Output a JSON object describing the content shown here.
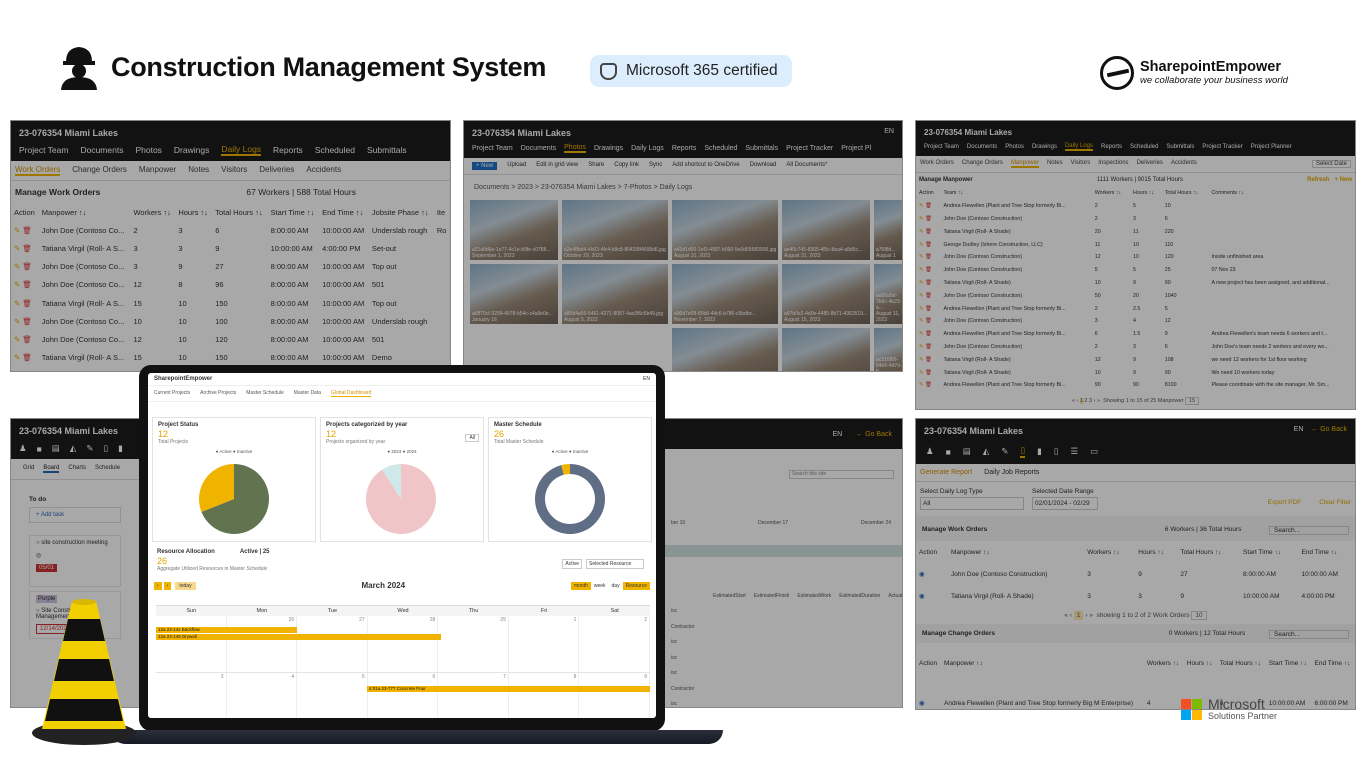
{
  "header": {
    "title": "Construction Management System",
    "badge": "Microsoft 365 certified",
    "logo_name": "SharepointEmpower",
    "logo_tagline": "we collaborate your business world"
  },
  "p1": {
    "title": "23-076354 Miami Lakes",
    "tabs": [
      "Project Team",
      "Documents",
      "Photos",
      "Drawings",
      "Daily Logs",
      "Reports",
      "Scheduled",
      "Submittals"
    ],
    "subtabs": [
      "Work Orders",
      "Change Orders",
      "Manpower",
      "Notes",
      "Visitors",
      "Deliveries",
      "Accidents"
    ],
    "heading": "Manage Work Orders",
    "summary": "67 Workers | 588 Total Hours",
    "cols": [
      "Action",
      "Manpower ↑↓",
      "Workers ↑↓",
      "Hours ↑↓",
      "Total Hours ↑↓",
      "Start Time ↑↓",
      "End Time ↑↓",
      "Jobsite Phase ↑↓",
      "Ite"
    ],
    "rows": [
      [
        "John Doe (Contoso Co...",
        "2",
        "3",
        "6",
        "8:00:00 AM",
        "10:00:00 AM",
        "Underslab rough",
        "Ro"
      ],
      [
        "Tatiana Virgil (Roll- A S...",
        "3",
        "3",
        "9",
        "10:00:00 AM",
        "4:00:00 PM",
        "Set-out",
        ""
      ],
      [
        "John Doe (Contoso Co...",
        "3",
        "9",
        "27",
        "8:00:00 AM",
        "10:00:00 AM",
        "Top out",
        ""
      ],
      [
        "John Doe (Contoso Co...",
        "12",
        "8",
        "96",
        "8:00:00 AM",
        "10:00:00 AM",
        "501",
        ""
      ],
      [
        "Tatiana Virgil (Roll- A S...",
        "15",
        "10",
        "150",
        "8:00:00 AM",
        "10:00:00 AM",
        "Top out",
        ""
      ],
      [
        "John Doe (Contoso Co...",
        "10",
        "10",
        "100",
        "8:00:00 AM",
        "10:00:00 AM",
        "Underslab rough",
        ""
      ],
      [
        "John Doe (Contoso Co...",
        "12",
        "10",
        "120",
        "8:00:00 AM",
        "10:00:00 AM",
        "501",
        ""
      ],
      [
        "Tatiana Virgil (Roll- A S...",
        "15",
        "10",
        "150",
        "8:00:00 AM",
        "10:00:00 AM",
        "Demo",
        ""
      ]
    ]
  },
  "p2": {
    "title": "23-076354 Miami Lakes",
    "lang": "EN",
    "tabs": [
      "Project Team",
      "Documents",
      "Photos",
      "Drawings",
      "Daily Logs",
      "Reports",
      "Scheduled",
      "Submittals",
      "Project Tracker",
      "Project Pl"
    ],
    "toolbar": [
      "+ New",
      "Upload",
      "Edit in grid view",
      "Share",
      "Copy link",
      "Sync",
      "Add shortcut to OneDrive",
      "Download",
      "All Documents*"
    ],
    "breadcrumb": "Documents > 2023 > 23-076354 Miami Lakes > 7-Photos > Daily Logs",
    "photos": [
      {
        "name": "a21a8d6e-1e77-4c1e-b9fe-c0788...",
        "date": "September 1, 2023"
      },
      {
        "name": "a2e48bd4-4b03-4fc4-b9c8-8042084698d6.jpg",
        "date": "October 29, 2023"
      },
      {
        "name": "a43d1d00-1ef3-4997-b090-5e0d09583906.jpg",
        "date": "August 31, 2023"
      },
      {
        "name": "ae40c745-8365-4f5c-8ea4-a8d5c...",
        "date": "August 31, 2023"
      },
      {
        "name": "a76f8d...",
        "date": "August 1"
      },
      {
        "name": "a6ff79cf-3299-4978-b54c-c4a9e0e...",
        "date": "January 16"
      },
      {
        "name": "a80d4a56-5461-4271-8087-4ac0f6c6b49.jpg",
        "date": "August 5, 2023"
      },
      {
        "name": "a90d7e08-80b8-44c6-b786-c5bdbc...",
        "date": "November 7, 2023"
      },
      {
        "name": "a97b0e2-4d0e-4485-8b71-4363519...",
        "date": "August 15, 2023"
      },
      {
        "name": "aa56a5d-7b6c-4b23-a...",
        "date": "August 11, 2023"
      },
      {
        "name": "",
        "date": ""
      },
      {
        "name": "",
        "date": ""
      },
      {
        "name": "aa03a7d-0e5c-4e43-a3c7-af34736...",
        "date": "August 30, 2023"
      },
      {
        "name": "abcd01b-6b4a-4b44-b00a-c0b4836...",
        "date": "August 1, 2023"
      },
      {
        "name": "ac316f66-64e5-4d7d-8...",
        "date": "August 5, 2023"
      }
    ]
  },
  "p3": {
    "title": "23-076354 Miami Lakes",
    "tabs": [
      "Project Team",
      "Documents",
      "Photos",
      "Drawings",
      "Daily Logs",
      "Reports",
      "Scheduled",
      "Submittals",
      "Project Tracker",
      "Project Planner"
    ],
    "subtabs": [
      "Work Orders",
      "Change Orders",
      "Manpower",
      "Notes",
      "Visitors",
      "Inspections",
      "Deliveries",
      "Accidents"
    ],
    "heading": "Manage Manpower",
    "summary": "1111 Workers | 9015 Total Hours",
    "refresh": "Refresh",
    "add": "+ New",
    "select_date": "Select Date",
    "cols": [
      "Action",
      "Team ↑↓",
      "Workers ↑↓",
      "Hours ↑↓",
      "Total Hours ↑↓",
      "Comments ↑↓"
    ],
    "rows": [
      [
        "Andrea Flewellen (Plant and Tree Stop formerly Bi...",
        "2",
        "5",
        "10",
        ""
      ],
      [
        "John Doe (Contoso Construction)",
        "2",
        "3",
        "6",
        ""
      ],
      [
        "Tatiana Virgil (Roll- A Shade)",
        "20",
        "11",
        "220",
        ""
      ],
      [
        "George Dudley (Ishere Construction, LLC)",
        "11",
        "10",
        "110",
        ""
      ],
      [
        "John Doe (Contoso Construction)",
        "12",
        "10",
        "120",
        "Inside unfinished area"
      ],
      [
        "John Doe (Contoso Construction)",
        "5",
        "5",
        "25",
        "07 Nov 23"
      ],
      [
        "Tatiana Virgil (Roll- A Shade)",
        "10",
        "9",
        "90",
        "A new project has been assigned, and additional..."
      ],
      [
        "John Doe (Contoso Construction)",
        "50",
        "20",
        "1040",
        ""
      ],
      [
        "Andrea Flewellen (Plant and Tree Stop formerly Bi...",
        "2",
        "2.5",
        "5",
        ""
      ],
      [
        "John Doe (Contoso Construction)",
        "3",
        "4",
        "12",
        ""
      ],
      [
        "Andrea Flewellen (Plant and Tree Stop formerly Bi...",
        "6",
        "1.5",
        "9",
        "Andrea Flewellen's team needs 6 workers and t..."
      ],
      [
        "John Doe (Contoso Construction)",
        "2",
        "3",
        "6",
        "John Doe's team needs 2 workers and every wo..."
      ],
      [
        "Tatiana Virgil (Roll- A Shade)",
        "12",
        "9",
        "108",
        "we need 12 workers for 1st floor working"
      ],
      [
        "Tatiana Virgil (Roll- A Shade)",
        "10",
        "9",
        "90",
        "We need 10 workers today"
      ],
      [
        "Andrea Flewellen (Plant and Tree Stop formerly Bi...",
        "90",
        "90",
        "8100",
        "Please coordinate with the site manager, Mr. Sm..."
      ]
    ],
    "paging": "Showing 1 to 15 of 25 Manpower",
    "pages": [
      "1",
      "2",
      "3"
    ],
    "per_page": "15"
  },
  "p4": {
    "title": "23-076354 Miami Lakes",
    "views": [
      "Grid",
      "Board",
      "Charts",
      "Schedule"
    ],
    "todo": "To do",
    "add_task": "+ Add task",
    "tasks": [
      "site construction meeting",
      "Site Construction Management"
    ],
    "date1": "05/01",
    "tag": "Purple",
    "date2": "12/14/2023"
  },
  "p5": {
    "lang": "EN",
    "back": "Go Back",
    "search": "Search this site",
    "dates": [
      "ber 10",
      "December 17",
      "December 24"
    ],
    "cols": [
      "EstimatedStart",
      "EstimatedFinish",
      "EstimatedWork",
      "EstimatedDuration",
      "ActualStart"
    ],
    "frags": [
      "isc",
      "Contractor",
      "isc",
      "isc",
      "isc",
      "Contractor",
      "isc"
    ]
  },
  "p6": {
    "title": "23-076354 Miami Lakes",
    "lang": "EN",
    "back": "Go Back",
    "tabs": [
      "Generate Report",
      "Daily Job Reports"
    ],
    "filter1_label": "Select Daily Log Type",
    "filter1_value": "All",
    "filter2_label": "Selected Date Range",
    "filter2_value": "02/01/2024 - 02/29",
    "export": "Export PDF",
    "clear": "Clear Filter",
    "heading": "Manage Work Orders",
    "summary": "6 Workers | 36 Total Hours",
    "search": "Search...",
    "cols": [
      "Action",
      "Manpower ↑↓",
      "Workers ↑↓",
      "Hours ↑↓",
      "Total Hours ↑↓",
      "Start Time ↑↓",
      "End Time ↑↓"
    ],
    "rows": [
      [
        "John Doe (Contoso Construction)",
        "3",
        "9",
        "27",
        "8:00:00 AM",
        "10:00:00 AM"
      ],
      [
        "Tatiana Virgil (Roll- A Shade)",
        "3",
        "3",
        "9",
        "10:00:00 AM",
        "4:00:00 PM"
      ]
    ],
    "paging": "showing 1 to 2 of 2 Work Orders",
    "page": "1",
    "per_page": "10",
    "heading2": "Manage Change Orders",
    "summary2": "0 Workers | 12 Total Hours",
    "search2": "Search...",
    "cols2": [
      "Action",
      "Manpower ↑↓",
      "Workers ↑↓",
      "Hours ↑↓",
      "Total Hours ↑↓",
      "Start Time ↑↓",
      "End Time ↑↓"
    ],
    "rows2": [
      [
        "Andrea Flewellen (Plant and Tree Stop formerly Big M Enterprise)",
        "4",
        "2",
        "8",
        "10:00:00 AM",
        "6:00:00 PM"
      ]
    ]
  },
  "laptop": {
    "logo": "SharepointEmpower",
    "lang": "EN",
    "nav": [
      "Current Projects",
      "Archive Projects",
      "Master Schedule",
      "Master Data",
      "Global Dashboard"
    ],
    "cards": [
      {
        "title": "Project Status",
        "num": "12",
        "sub": "Total Projects",
        "legend": [
          "Active",
          "Inactive"
        ]
      },
      {
        "title": "Projects categorized by year",
        "num": "12",
        "sub": "Projects organized by year",
        "legend": [
          "2023",
          "2024"
        ],
        "select": "All"
      },
      {
        "title": "Master Schedule",
        "num": "26",
        "sub": "Total Master Schedule",
        "legend": [
          "Active",
          "Inactive"
        ]
      }
    ],
    "resource": {
      "title": "Resource Allocation",
      "active": "Active | 25",
      "num": "26",
      "sub": "Aggregate Utilized Resources in Master Schedule",
      "sel1": "Active",
      "sel2": "Selected Resource"
    },
    "calendar": {
      "title": "March 2024",
      "today": "today",
      "views": [
        "month",
        "week",
        "day",
        "Resource"
      ],
      "days": [
        "Sun",
        "Mon",
        "Tue",
        "Wed",
        "Thu",
        "Fri",
        "Sat"
      ],
      "row1": [
        "",
        "26",
        "27",
        "28",
        "29",
        "1",
        "2"
      ],
      "row2": [
        "3",
        "4",
        "5",
        "6",
        "7",
        "8",
        "9"
      ],
      "events": [
        "12a 23-14x Backflow",
        "12a 23-145 Drywall",
        "4:01a 23-777 Concrete Pour"
      ]
    }
  },
  "partner": {
    "name": "Microsoft",
    "sub": "Solutions Partner"
  },
  "colors": {
    "accent": "#f0b400",
    "dark": "#1c1c1c",
    "slate": "#5f6e85",
    "olive": "#627350",
    "pink": "#f0c5c8"
  }
}
